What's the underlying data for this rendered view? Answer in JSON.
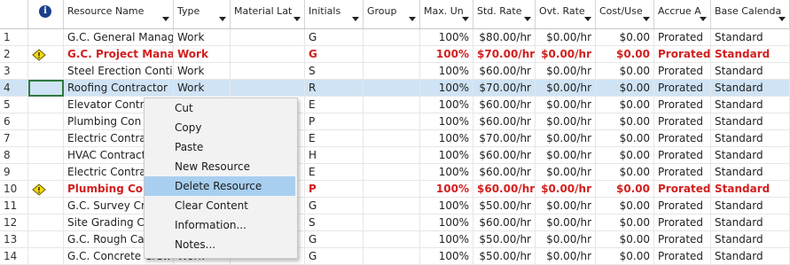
{
  "header": {
    "info_icon": "info-icon",
    "columns": [
      "Resource Name",
      "Type",
      "Material Lat",
      "Initials",
      "Group",
      "Max. Un",
      "Std. Rate",
      "Ovt. Rate",
      "Cost/Use",
      "Accrue A",
      "Base Calenda"
    ]
  },
  "rows": [
    {
      "n": "1",
      "warn": false,
      "red": false,
      "name": "G.C. General Manag",
      "type": "Work",
      "init": "G",
      "max": "100%",
      "std": "$80.00/hr",
      "ovt": "$0.00/hr",
      "cost": "$0.00",
      "accrue": "Prorated",
      "cal": "Standard"
    },
    {
      "n": "2",
      "warn": true,
      "red": true,
      "name": "G.C. Project Manag",
      "type": "Work",
      "init": "G",
      "max": "100%",
      "std": "$70.00/hr",
      "ovt": "$0.00/hr",
      "cost": "$0.00",
      "accrue": "Prorated",
      "cal": "Standard"
    },
    {
      "n": "3",
      "warn": false,
      "red": false,
      "name": "Steel Erection Conti",
      "type": "Work",
      "init": "S",
      "max": "100%",
      "std": "$60.00/hr",
      "ovt": "$0.00/hr",
      "cost": "$0.00",
      "accrue": "Prorated",
      "cal": "Standard"
    },
    {
      "n": "4",
      "warn": false,
      "red": false,
      "name": "Roofing Contractor",
      "type": "Work",
      "init": "R",
      "max": "100%",
      "std": "$70.00/hr",
      "ovt": "$0.00/hr",
      "cost": "$0.00",
      "accrue": "Prorated",
      "cal": "Standard"
    },
    {
      "n": "5",
      "warn": false,
      "red": false,
      "name": "Elevator Contr",
      "type": "",
      "init": "E",
      "max": "100%",
      "std": "$60.00/hr",
      "ovt": "$0.00/hr",
      "cost": "$0.00",
      "accrue": "Prorated",
      "cal": "Standard"
    },
    {
      "n": "6",
      "warn": false,
      "red": false,
      "name": "Plumbing Con",
      "type": "",
      "init": "P",
      "max": "100%",
      "std": "$60.00/hr",
      "ovt": "$0.00/hr",
      "cost": "$0.00",
      "accrue": "Prorated",
      "cal": "Standard"
    },
    {
      "n": "7",
      "warn": false,
      "red": false,
      "name": "Electric Contra",
      "type": "",
      "init": "E",
      "max": "100%",
      "std": "$70.00/hr",
      "ovt": "$0.00/hr",
      "cost": "$0.00",
      "accrue": "Prorated",
      "cal": "Standard"
    },
    {
      "n": "8",
      "warn": false,
      "red": false,
      "name": "HVAC Contract",
      "type": "",
      "init": "H",
      "max": "100%",
      "std": "$60.00/hr",
      "ovt": "$0.00/hr",
      "cost": "$0.00",
      "accrue": "Prorated",
      "cal": "Standard"
    },
    {
      "n": "9",
      "warn": false,
      "red": false,
      "name": "Electric Contra",
      "type": "",
      "init": "E",
      "max": "100%",
      "std": "$60.00/hr",
      "ovt": "$0.00/hr",
      "cost": "$0.00",
      "accrue": "Prorated",
      "cal": "Standard"
    },
    {
      "n": "10",
      "warn": true,
      "red": true,
      "name": "Plumbing Con",
      "type": "",
      "init": "P",
      "max": "100%",
      "std": "$60.00/hr",
      "ovt": "$0.00/hr",
      "cost": "$0.00",
      "accrue": "Prorated",
      "cal": "Standard"
    },
    {
      "n": "11",
      "warn": false,
      "red": false,
      "name": "G.C. Survey Cr",
      "type": "",
      "init": "G",
      "max": "100%",
      "std": "$50.00/hr",
      "ovt": "$0.00/hr",
      "cost": "$0.00",
      "accrue": "Prorated",
      "cal": "Standard"
    },
    {
      "n": "12",
      "warn": false,
      "red": false,
      "name": "Site Grading C",
      "type": "",
      "init": "S",
      "max": "100%",
      "std": "$60.00/hr",
      "ovt": "$0.00/hr",
      "cost": "$0.00",
      "accrue": "Prorated",
      "cal": "Standard"
    },
    {
      "n": "13",
      "warn": false,
      "red": false,
      "name": "G.C. Rough Ca",
      "type": "",
      "init": "G",
      "max": "100%",
      "std": "$50.00/hr",
      "ovt": "$0.00/hr",
      "cost": "$0.00",
      "accrue": "Prorated",
      "cal": "Standard"
    },
    {
      "n": "14",
      "warn": false,
      "red": false,
      "name": "G.C. Concrete Crew",
      "type": "Work",
      "init": "G",
      "max": "100%",
      "std": "$50.00/hr",
      "ovt": "$0.00/hr",
      "cost": "$0.00",
      "accrue": "Prorated",
      "cal": "Standard"
    }
  ],
  "context_menu": {
    "items": [
      "Cut",
      "Copy",
      "Paste",
      "New Resource",
      "Delete Resource",
      "Clear Content",
      "Information...",
      "Notes..."
    ],
    "highlighted": "Delete Resource"
  },
  "colors": {
    "overallocated": "#d21f1f",
    "selection": "#cfe3f5",
    "menu_highlight": "#a8cff0",
    "warning": "#f5d90a"
  }
}
